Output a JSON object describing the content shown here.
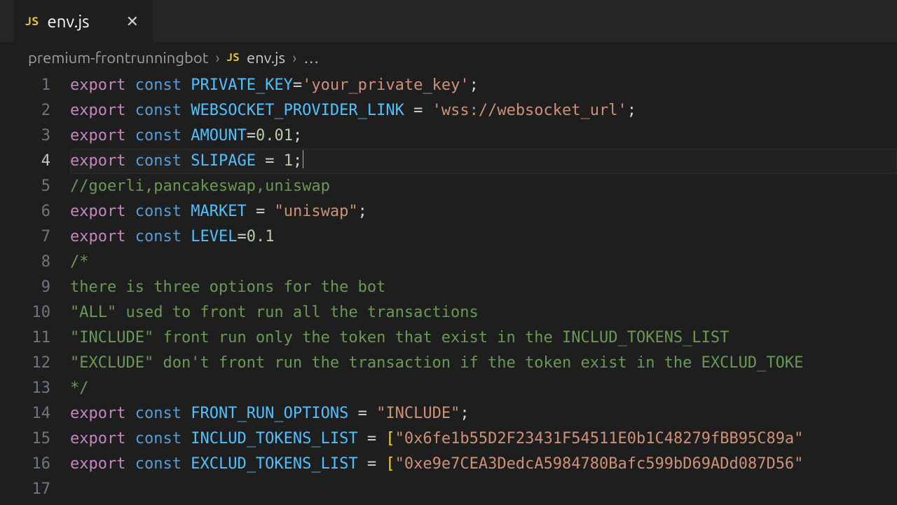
{
  "tab": {
    "icon_label": "JS",
    "filename": "env.js",
    "close_glyph": "✕"
  },
  "breadcrumb": {
    "folder": "premium-frontrunningbot",
    "sep": "›",
    "icon_label": "JS",
    "file": "env.js",
    "tail": "…"
  },
  "editor": {
    "active_line": 4,
    "lines": [
      {
        "n": 1,
        "tokens": [
          [
            "kw",
            "export"
          ],
          [
            "sp",
            " "
          ],
          [
            "stor",
            "const"
          ],
          [
            "sp",
            " "
          ],
          [
            "varname",
            "PRIVATE_KEY"
          ],
          [
            "op",
            "="
          ],
          [
            "str",
            "'your_private_key'"
          ],
          [
            "pun",
            ";"
          ]
        ]
      },
      {
        "n": 2,
        "tokens": [
          [
            "kw",
            "export"
          ],
          [
            "sp",
            " "
          ],
          [
            "stor",
            "const"
          ],
          [
            "sp",
            " "
          ],
          [
            "varname",
            "WEBSOCKET_PROVIDER_LINK"
          ],
          [
            "sp",
            " "
          ],
          [
            "op",
            "="
          ],
          [
            "sp",
            " "
          ],
          [
            "str",
            "'wss://websocket_url'"
          ],
          [
            "pun",
            ";"
          ]
        ]
      },
      {
        "n": 3,
        "tokens": [
          [
            "kw",
            "export"
          ],
          [
            "sp",
            " "
          ],
          [
            "stor",
            "const"
          ],
          [
            "sp",
            " "
          ],
          [
            "varname",
            "AMOUNT"
          ],
          [
            "op",
            "="
          ],
          [
            "num",
            "0.01"
          ],
          [
            "pun",
            ";"
          ]
        ]
      },
      {
        "n": 4,
        "tokens": [
          [
            "kw",
            "export"
          ],
          [
            "sp",
            " "
          ],
          [
            "stor",
            "const"
          ],
          [
            "sp",
            " "
          ],
          [
            "varname",
            "SLIPAGE"
          ],
          [
            "sp",
            " "
          ],
          [
            "op",
            "="
          ],
          [
            "sp",
            " "
          ],
          [
            "num",
            "1"
          ],
          [
            "pun",
            ";"
          ],
          [
            "caret",
            ""
          ]
        ]
      },
      {
        "n": 5,
        "tokens": [
          [
            "cmt",
            "//goerli,pancakeswap,uniswap"
          ]
        ]
      },
      {
        "n": 6,
        "tokens": [
          [
            "kw",
            "export"
          ],
          [
            "sp",
            " "
          ],
          [
            "stor",
            "const"
          ],
          [
            "sp",
            " "
          ],
          [
            "varname",
            "MARKET"
          ],
          [
            "sp",
            " "
          ],
          [
            "op",
            "="
          ],
          [
            "sp",
            " "
          ],
          [
            "str",
            "\"uniswap\""
          ],
          [
            "pun",
            ";"
          ]
        ]
      },
      {
        "n": 7,
        "tokens": [
          [
            "kw",
            "export"
          ],
          [
            "sp",
            " "
          ],
          [
            "stor",
            "const"
          ],
          [
            "sp",
            " "
          ],
          [
            "varname",
            "LEVEL"
          ],
          [
            "op",
            "="
          ],
          [
            "num",
            "0.1"
          ]
        ]
      },
      {
        "n": 8,
        "tokens": [
          [
            "cmt",
            "/*"
          ]
        ]
      },
      {
        "n": 9,
        "tokens": [
          [
            "cmt",
            "there is three options for the bot"
          ]
        ]
      },
      {
        "n": 10,
        "tokens": [
          [
            "cmt",
            "\"ALL\" used to front run all the transactions"
          ]
        ]
      },
      {
        "n": 11,
        "tokens": [
          [
            "cmt",
            "\"INCLUDE\" front run only the token that exist in the INCLUD_TOKENS_LIST"
          ]
        ]
      },
      {
        "n": 12,
        "tokens": [
          [
            "cmt",
            "\"EXCLUDE\" don't front run the transaction if the token exist in the EXCLUD_TOKE"
          ]
        ]
      },
      {
        "n": 13,
        "tokens": [
          [
            "cmt",
            "*/"
          ]
        ]
      },
      {
        "n": 14,
        "tokens": [
          [
            "kw",
            "export"
          ],
          [
            "sp",
            " "
          ],
          [
            "stor",
            "const"
          ],
          [
            "sp",
            " "
          ],
          [
            "varname",
            "FRONT_RUN_OPTIONS"
          ],
          [
            "sp",
            " "
          ],
          [
            "op",
            "="
          ],
          [
            "sp",
            " "
          ],
          [
            "str",
            "\"INCLUDE\""
          ],
          [
            "pun",
            ";"
          ]
        ]
      },
      {
        "n": 15,
        "tokens": [
          [
            "kw",
            "export"
          ],
          [
            "sp",
            " "
          ],
          [
            "stor",
            "const"
          ],
          [
            "sp",
            " "
          ],
          [
            "varname",
            "INCLUD_TOKENS_LIST"
          ],
          [
            "sp",
            " "
          ],
          [
            "op",
            "="
          ],
          [
            "sp",
            " "
          ],
          [
            "brk",
            "["
          ],
          [
            "str",
            "\"0x6fe1b55D2F23431F54511E0b1C48279fBB95C89a\""
          ]
        ]
      },
      {
        "n": 16,
        "tokens": [
          [
            "kw",
            "export"
          ],
          [
            "sp",
            " "
          ],
          [
            "stor",
            "const"
          ],
          [
            "sp",
            " "
          ],
          [
            "varname",
            "EXCLUD_TOKENS_LIST"
          ],
          [
            "sp",
            " "
          ],
          [
            "op",
            "="
          ],
          [
            "sp",
            " "
          ],
          [
            "brk",
            "["
          ],
          [
            "str",
            "\"0xe9e7CEA3DedcA5984780Bafc599bD69ADd087D56\""
          ]
        ]
      },
      {
        "n": 17,
        "tokens": []
      }
    ]
  }
}
